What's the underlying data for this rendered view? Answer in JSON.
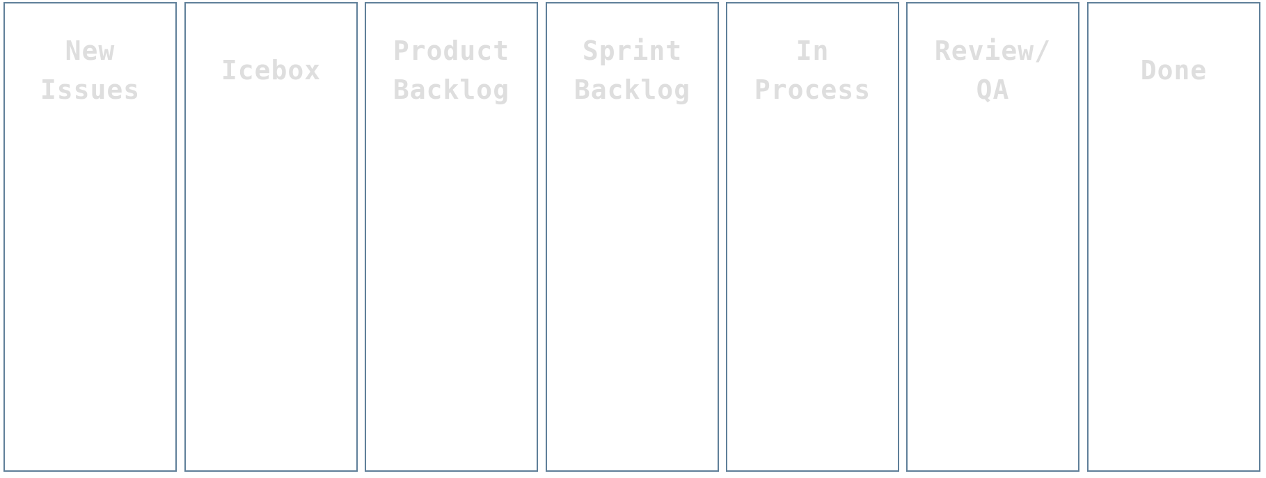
{
  "board": {
    "columns": [
      {
        "title": "New\nIssues"
      },
      {
        "title": "Icebox"
      },
      {
        "title": "Product\nBacklog"
      },
      {
        "title": "Sprint\nBacklog"
      },
      {
        "title": "In\nProcess"
      },
      {
        "title": "Review/\nQA"
      },
      {
        "title": "Done"
      }
    ]
  },
  "colors": {
    "column_border": "#5f7f99",
    "title_text": "#dedede",
    "background": "#ffffff"
  }
}
